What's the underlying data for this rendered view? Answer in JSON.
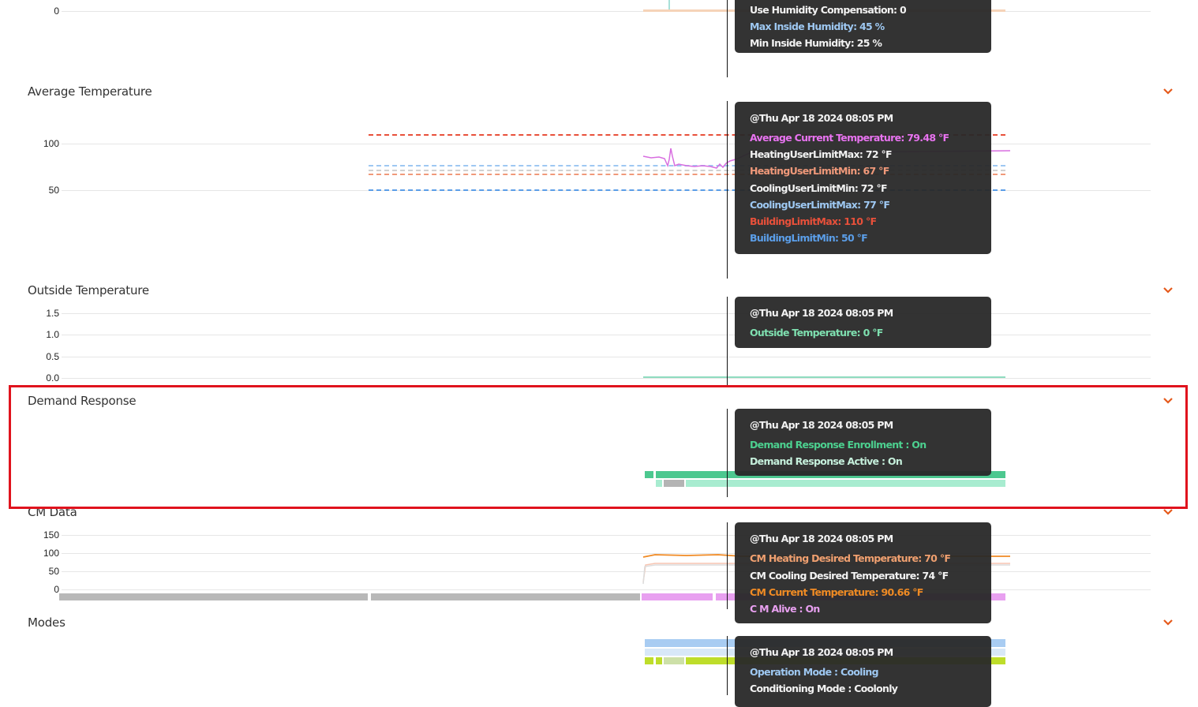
{
  "humidity": {
    "ytick": "0",
    "tooltip_rows": [
      {
        "text": "Use Humidity Compensation: 0",
        "color": "#f2f2f2"
      },
      {
        "text": "Max Inside Humidity: 45 %",
        "color": "#9ec8f2"
      },
      {
        "text": "Min Inside Humidity: 25 %",
        "color": "#f2f2f2"
      }
    ]
  },
  "avg_temp": {
    "title": "Average Temperature",
    "yticks": [
      "100",
      "50"
    ],
    "tooltip_header": "@Thu Apr 18 2024 08:05 PM",
    "tooltip_rows": [
      {
        "text": "Average Current Temperature: 79.48 °F",
        "color": "#e873f0"
      },
      {
        "text": "HeatingUserLimitMax: 72 °F",
        "color": "#f2f2f2"
      },
      {
        "text": "HeatingUserLimitMin: 67 °F",
        "color": "#f0997a"
      },
      {
        "text": "CoolingUserLimitMin: 72 °F",
        "color": "#f2f2f2"
      },
      {
        "text": "CoolingUserLimitMax: 77 °F",
        "color": "#9ec8f2"
      },
      {
        "text": "BuildingLimitMax: 110 °F",
        "color": "#e8503a"
      },
      {
        "text": "BuildingLimitMin: 50 °F",
        "color": "#5b9ee8"
      }
    ]
  },
  "outside_temp": {
    "title": "Outside Temperature",
    "yticks": [
      "1.5",
      "1.0",
      "0.5",
      "0.0"
    ],
    "tooltip_header": "@Thu Apr 18 2024 08:05 PM",
    "tooltip_rows": [
      {
        "text": "Outside Temperature: 0 °F",
        "color": "#7fe0b0"
      }
    ]
  },
  "demand_response": {
    "title": "Demand Response",
    "tooltip_header": "@Thu Apr 18 2024 08:05 PM",
    "tooltip_rows": [
      {
        "text": "Demand Response Enrollment : On",
        "color": "#4cd08f"
      },
      {
        "text": "Demand Response Active : On",
        "color": "#c6f0dc"
      }
    ]
  },
  "cm_data": {
    "title": "CM Data",
    "yticks": [
      "150",
      "100",
      "50",
      "0"
    ],
    "tooltip_header": "@Thu Apr 18 2024 08:05 PM",
    "tooltip_rows": [
      {
        "text": "CM Heating Desired Temperature: 70 °F",
        "color": "#f0a070"
      },
      {
        "text": "CM Cooling Desired Temperature: 74 °F",
        "color": "#f2f2f2"
      },
      {
        "text": "CM Current Temperature: 90.66 °F",
        "color": "#f08a24"
      },
      {
        "text": "C M Alive : On",
        "color": "#e8a0f0"
      }
    ]
  },
  "modes": {
    "title": "Modes",
    "tooltip_header": "@Thu Apr 18 2024 08:05 PM",
    "tooltip_rows": [
      {
        "text": "Operation Mode : Cooling",
        "color": "#9ec8f2"
      },
      {
        "text": "Conditioning Mode : Coolonly",
        "color": "#f2f2f2"
      }
    ]
  }
}
